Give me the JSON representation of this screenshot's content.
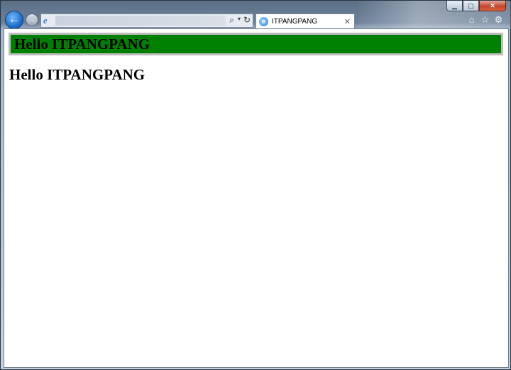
{
  "browser": {
    "tab": {
      "title": "ITPANGPANG",
      "icon": "ie-page-icon"
    },
    "address": {
      "url": "",
      "icon": "ie-icon"
    },
    "caption": {
      "minimize": "▁",
      "maximize": "▢",
      "close": "✕"
    },
    "nav": {
      "back": "←",
      "forward": "→"
    },
    "toolbar": {
      "home": "⌂",
      "favorites": "☆",
      "tools": "⚙"
    },
    "address_buttons": {
      "search": "⌕",
      "dropdown": "▾",
      "refresh": "↻"
    },
    "tab_close": "✕"
  },
  "page": {
    "banner_heading": "Hello ITPANGPANG",
    "heading": "Hello ITPANGPANG"
  },
  "colors": {
    "banner_background": "#008000",
    "banner_border": "#bcbcbc"
  }
}
